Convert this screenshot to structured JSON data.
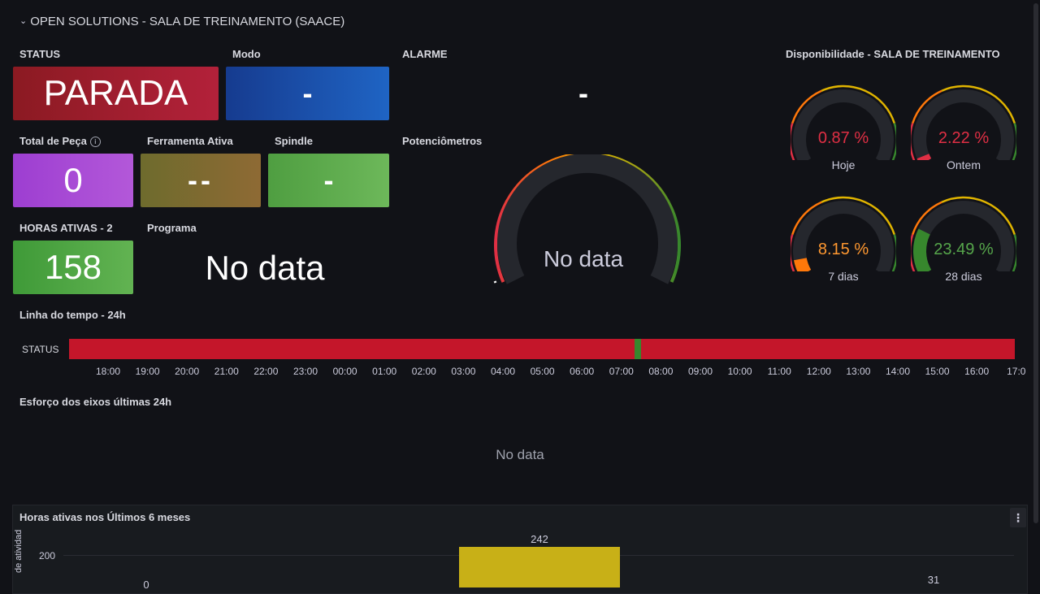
{
  "row": {
    "title": "OPEN SOLUTIONS - SALA DE TREINAMENTO (SAACE)"
  },
  "panels": {
    "status": {
      "title": "STATUS",
      "value": "PARADA"
    },
    "modo": {
      "title": "Modo",
      "value": "-"
    },
    "alarme": {
      "title": "ALARME",
      "value": "-"
    },
    "total_pecas": {
      "title": "Total de Peça",
      "value": "0"
    },
    "ferramenta": {
      "title": "Ferramenta Ativa",
      "value": "--"
    },
    "spindle": {
      "title": "Spindle",
      "value": "-"
    },
    "potenciometros": {
      "title": "Potenciômetros",
      "value": "No data"
    },
    "horas_ativas": {
      "title": "HORAS ATIVAS - 2",
      "value": "158"
    },
    "programa": {
      "title": "Programa",
      "value": "No data"
    }
  },
  "disponibilidade": {
    "title": "Disponibilidade - SALA DE TREINAMENTO",
    "gauges": [
      {
        "label": "Hoje",
        "value": "0.87 %",
        "fraction": 0.0087,
        "color": "#e02f44"
      },
      {
        "label": "Ontem",
        "value": "2.22 %",
        "fraction": 0.0222,
        "color": "#e02f44"
      },
      {
        "label": "7 dias",
        "value": "8.15 %",
        "fraction": 0.0815,
        "color": "#ff780a"
      },
      {
        "label": "28 dias",
        "value": "23.49 %",
        "fraction": 0.2349,
        "color": "#37872d"
      }
    ]
  },
  "timeline": {
    "title": "Linha do tempo - 24h",
    "row_label": "STATUS",
    "ticks": [
      "18:00",
      "19:00",
      "20:00",
      "21:00",
      "22:00",
      "23:00",
      "00:00",
      "01:00",
      "02:00",
      "03:00",
      "04:00",
      "05:00",
      "06:00",
      "07:00",
      "08:00",
      "09:00",
      "10:00",
      "11:00",
      "12:00",
      "13:00",
      "14:00",
      "15:00",
      "16:00",
      "17:0"
    ],
    "colors": {
      "stopped": "#c4162a",
      "running": "#37872d"
    }
  },
  "esforco": {
    "title": "Esforço dos eixos últimas 24h",
    "value": "No data"
  },
  "horas_6m": {
    "title": "Horas ativas nos Últimos 6 meses",
    "ylabel": "de atividad",
    "ytick": "200",
    "bar_labels": {
      "first": "0",
      "peak": "242",
      "last": "31"
    },
    "menu_icon": "kebab-menu-icon"
  },
  "colors": {
    "background": "#111217",
    "panel_bg": "#181b1f",
    "parada": "#a31c2a",
    "modo": "#1f60c4",
    "total": "#a352cc",
    "ferramenta": "#8f6a2c",
    "spindle": "#56a64b",
    "horas": "#56a64b",
    "bar": "#c8b017"
  }
}
